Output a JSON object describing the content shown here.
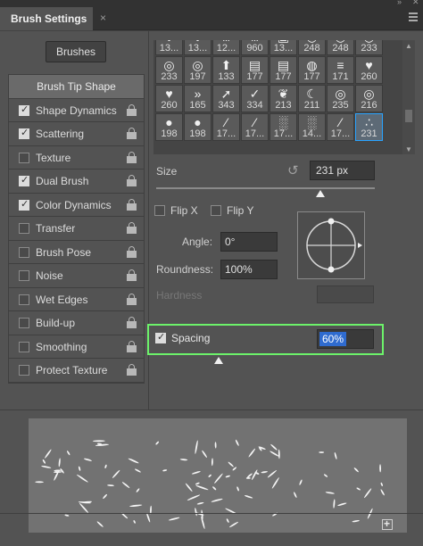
{
  "window": {
    "tab_title": "Brush Settings"
  },
  "left": {
    "brushes_button": "Brushes",
    "header": "Brush Tip Shape",
    "items": [
      {
        "label": "Shape Dynamics",
        "checked": true
      },
      {
        "label": "Scattering",
        "checked": true
      },
      {
        "label": "Texture",
        "checked": false
      },
      {
        "label": "Dual Brush",
        "checked": true
      },
      {
        "label": "Color Dynamics",
        "checked": true
      },
      {
        "label": "Transfer",
        "checked": false
      },
      {
        "label": "Brush Pose",
        "checked": false
      },
      {
        "label": "Noise",
        "checked": false
      },
      {
        "label": "Wet Edges",
        "checked": false
      },
      {
        "label": "Build-up",
        "checked": false
      },
      {
        "label": "Smoothing",
        "checked": false
      },
      {
        "label": "Protect Texture",
        "checked": false
      }
    ]
  },
  "brush_grid": [
    {
      "label": "13...",
      "icon": "splatter-icon"
    },
    {
      "label": "13...",
      "icon": "splatter-icon"
    },
    {
      "label": "12...",
      "icon": "grass-icon"
    },
    {
      "label": "960",
      "icon": "grass-icon"
    },
    {
      "label": "13...",
      "icon": "frame-icon"
    },
    {
      "label": "248",
      "icon": "ring-icon"
    },
    {
      "label": "248",
      "icon": "ring-icon"
    },
    {
      "label": "233",
      "icon": "ring-icon"
    },
    {
      "label": "233",
      "icon": "ring-icon"
    },
    {
      "label": "197",
      "icon": "ring-icon"
    },
    {
      "label": "133",
      "icon": "arrow-up-icon"
    },
    {
      "label": "177",
      "icon": "stripes-icon"
    },
    {
      "label": "177",
      "icon": "stripes-icon"
    },
    {
      "label": "177",
      "icon": "globe-icon"
    },
    {
      "label": "171",
      "icon": "dashes-icon"
    },
    {
      "label": "260",
      "icon": "heart-icon"
    },
    {
      "label": "260",
      "icon": "heart-icon"
    },
    {
      "label": "165",
      "icon": "chevrons-icon"
    },
    {
      "label": "343",
      "icon": "arrows-icon"
    },
    {
      "label": "334",
      "icon": "check-icon"
    },
    {
      "label": "213",
      "icon": "leaf-icon"
    },
    {
      "label": "211",
      "icon": "moon-icon"
    },
    {
      "label": "235",
      "icon": "ring-icon"
    },
    {
      "label": "216",
      "icon": "ring-icon"
    },
    {
      "label": "198",
      "icon": "dot-icon"
    },
    {
      "label": "198",
      "icon": "dot-icon"
    },
    {
      "label": "17...",
      "icon": "feather-icon"
    },
    {
      "label": "17...",
      "icon": "feather-icon"
    },
    {
      "label": "17...",
      "icon": "texture-icon"
    },
    {
      "label": "14...",
      "icon": "texture-icon"
    },
    {
      "label": "17...",
      "icon": "feather-icon"
    },
    {
      "label": "231",
      "icon": "scatter-icon",
      "selected": true
    }
  ],
  "tip": {
    "size_label": "Size",
    "size_value": "231 px",
    "size_fraction": 0.75,
    "flip_x": "Flip X",
    "flip_y": "Flip Y",
    "angle_label": "Angle:",
    "angle_value": "0°",
    "roundness_label": "Roundness:",
    "roundness_value": "100%",
    "hardness_label": "Hardness",
    "spacing_label": "Spacing",
    "spacing_value": "60%",
    "spacing_fraction": 0.2
  }
}
